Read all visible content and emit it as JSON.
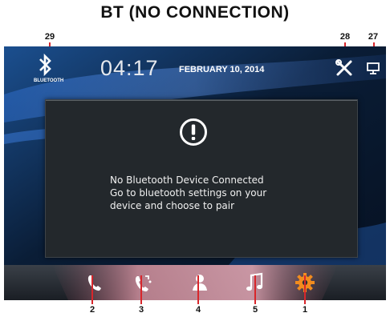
{
  "heading": "BT (NO CONNECTION)",
  "callouts": {
    "bluetooth": "29",
    "settings": "28",
    "display": "27",
    "phone": "2",
    "recent_calls": "3",
    "contacts": "4",
    "music": "5",
    "settings_gear": "1"
  },
  "status_bar": {
    "bluetooth_label": "BLUETOOTH",
    "time": "04:17",
    "date": "FEBRUARY 10, 2014"
  },
  "dialog": {
    "icon": "warning-icon",
    "lines": [
      "No Bluetooth Device Connected",
      "Go to bluetooth settings on your",
      "device and choose to pair"
    ]
  },
  "dock": {
    "buttons": [
      "phone-icon",
      "recent-calls-icon",
      "contacts-icon",
      "music-icon",
      "gear-icon"
    ]
  },
  "colors": {
    "accent_orange": "#f28c1e",
    "callout_red": "#d8262b",
    "dialog_bg": "#23282c"
  }
}
